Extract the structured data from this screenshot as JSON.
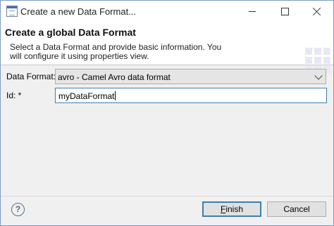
{
  "window": {
    "title": "Create a new Data Format..."
  },
  "header": {
    "title": "Create a global Data Format",
    "message": "Select a Data Format and provide basic information. You will configure it using properties view."
  },
  "form": {
    "data_format_label": "Data Format:",
    "data_format_value": "avro - Camel Avro data format",
    "id_label": "Id: *",
    "id_value": "myDataFormat"
  },
  "buttons": {
    "help_label": "?",
    "finish_mnemonic": "F",
    "finish_rest": "inish",
    "cancel_label": "Cancel"
  }
}
